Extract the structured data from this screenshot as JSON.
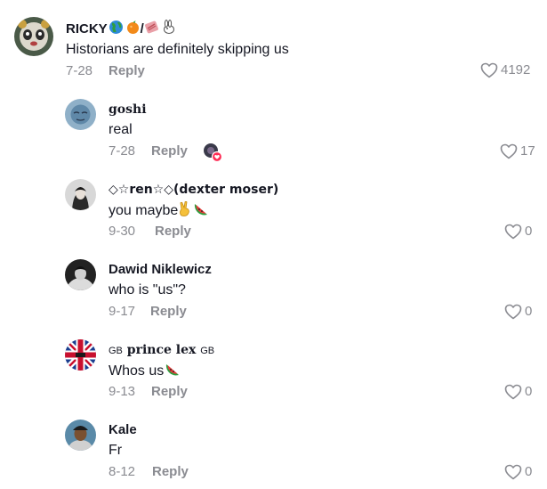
{
  "comments": [
    {
      "username": "RICKY",
      "username_suffix": "/",
      "text": "Historians are definitely skipping us",
      "date": "7-28",
      "reply_label": "Reply",
      "likes": "4192"
    },
    {
      "username": "goshi",
      "text": "real",
      "date": "7-28",
      "reply_label": "Reply",
      "likes": "17",
      "liked_by_creator": true
    },
    {
      "username": "◇☆ren☆◇(dexter moser)",
      "text": "you maybe",
      "date": "9-30",
      "reply_label": "Reply",
      "likes": "0"
    },
    {
      "username": "Dawid Niklewicz",
      "text": "who is \"us\"?",
      "date": "9-17",
      "reply_label": "Reply",
      "likes": "0"
    },
    {
      "username": "prince lex",
      "username_prefix": "GB",
      "username_suffix": "GB",
      "text": "Whos us",
      "date": "9-13",
      "reply_label": "Reply",
      "likes": "0"
    },
    {
      "username": "Kale",
      "text": "Fr",
      "date": "8-12",
      "reply_label": "Reply",
      "likes": "0"
    }
  ],
  "icons": {
    "like": "heart-outline-icon",
    "creator_like": "creator-liked-heart-icon"
  },
  "colors": {
    "text": "#161823",
    "muted": "#8a8b91",
    "creator_badge": "#fe2c55"
  }
}
